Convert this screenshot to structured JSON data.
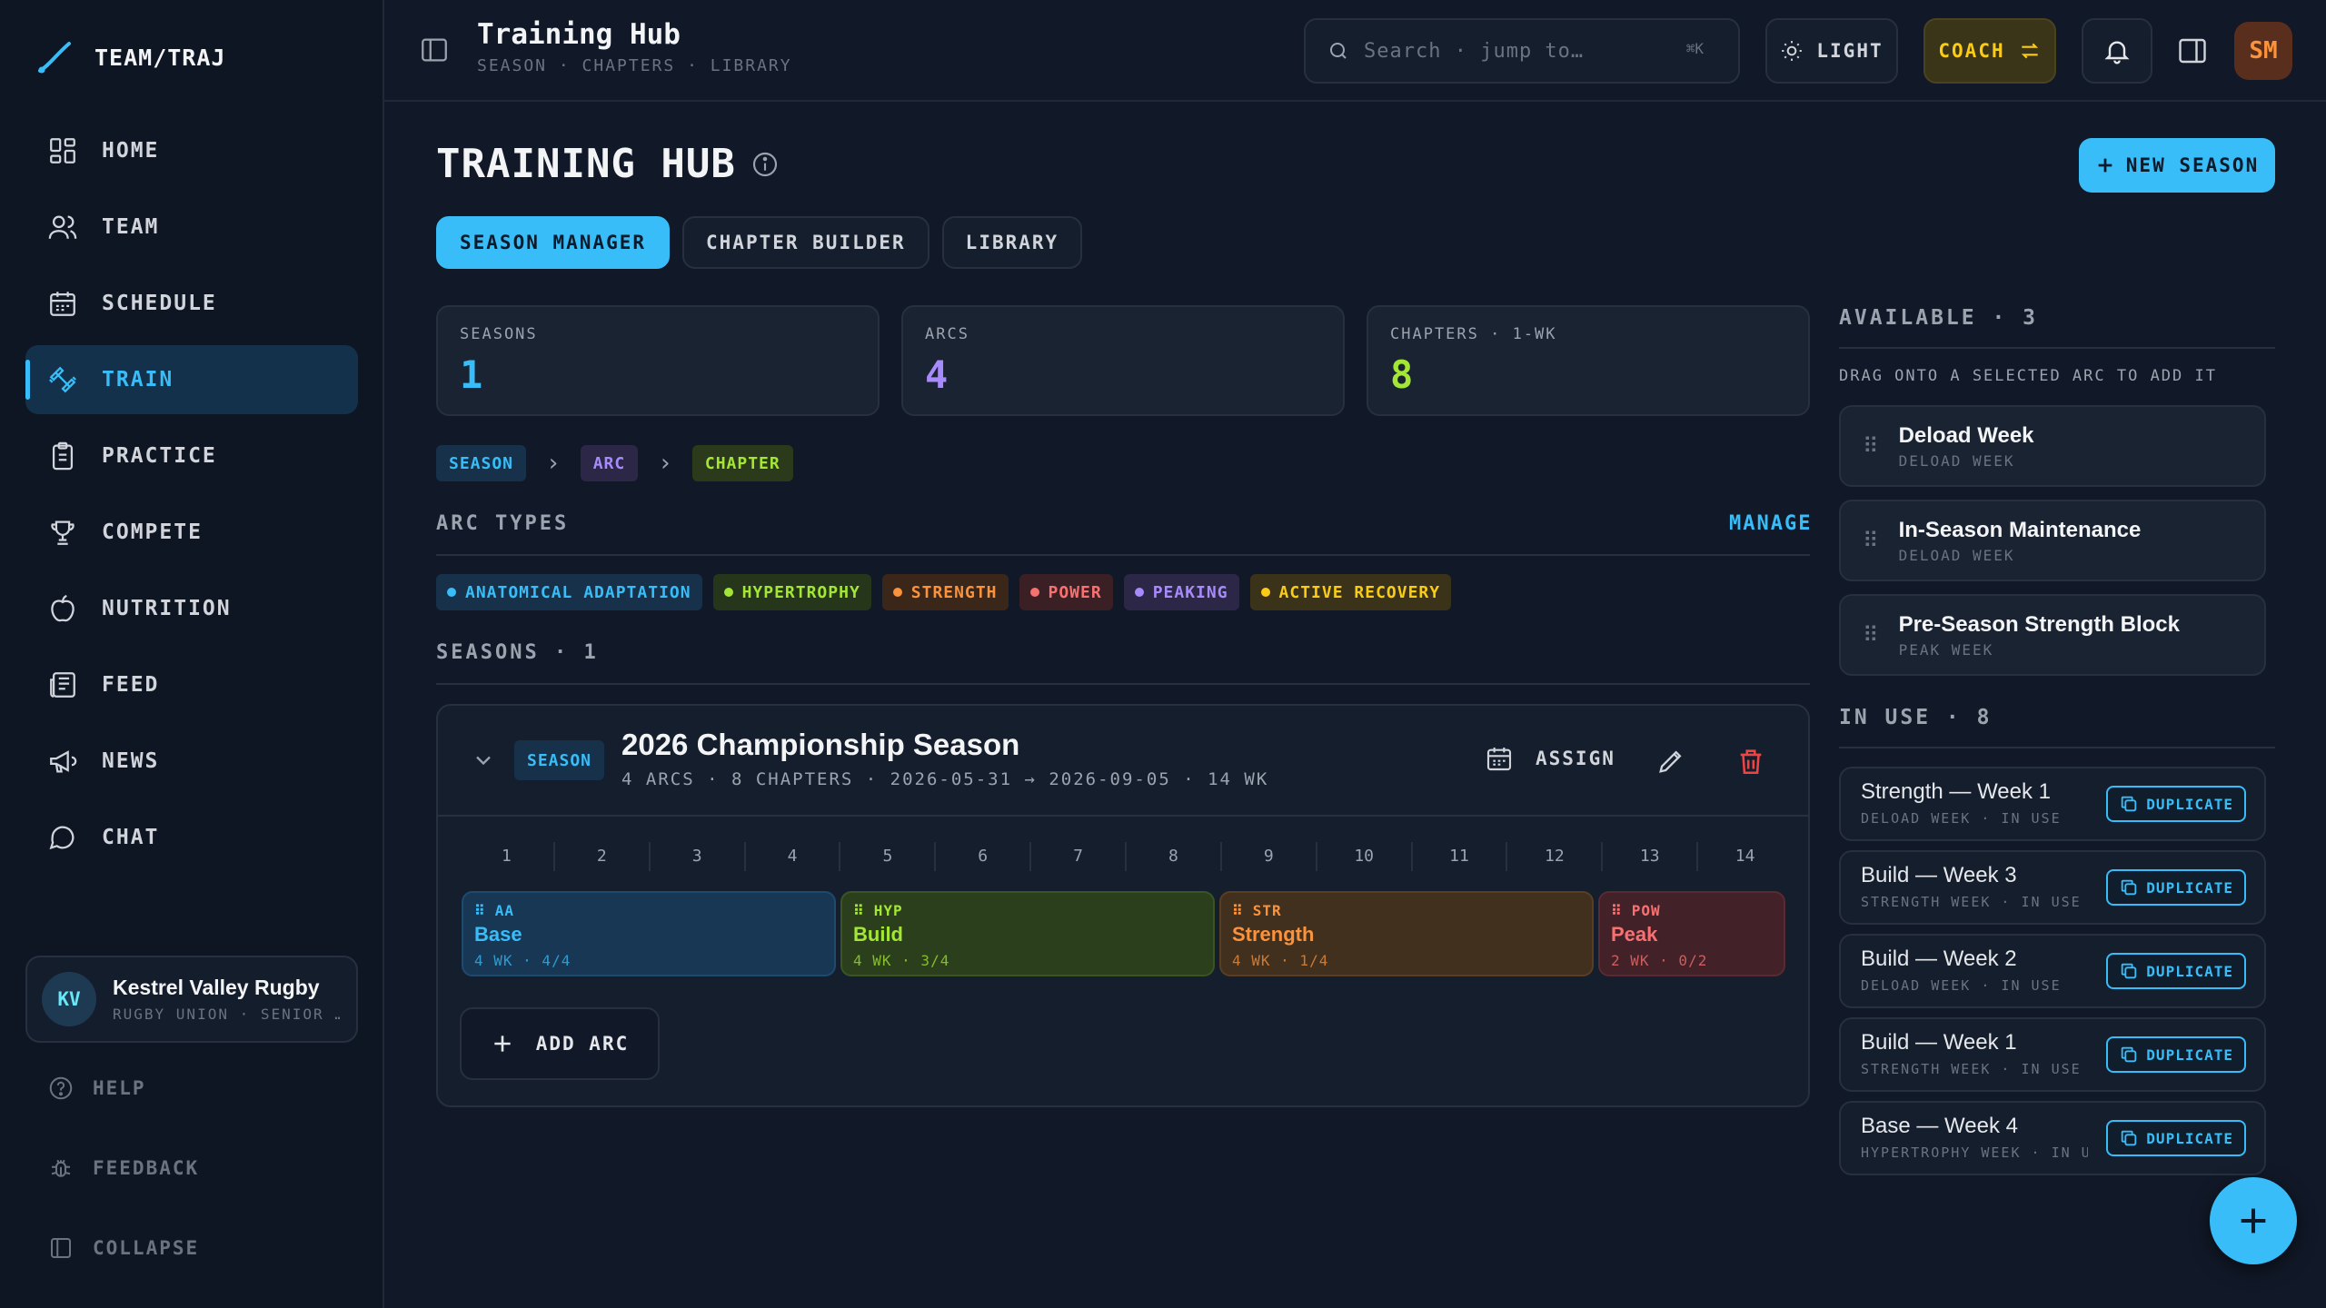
{
  "app": {
    "logo_text": "TEAM/TRAJ"
  },
  "sidebar": {
    "items": [
      {
        "label": "HOME",
        "icon": "grid-icon"
      },
      {
        "label": "TEAM",
        "icon": "users-icon"
      },
      {
        "label": "SCHEDULE",
        "icon": "calendar-icon"
      },
      {
        "label": "TRAIN",
        "icon": "dumbbell-icon",
        "active": true
      },
      {
        "label": "PRACTICE",
        "icon": "clipboard-icon"
      },
      {
        "label": "COMPETE",
        "icon": "trophy-icon"
      },
      {
        "label": "NUTRITION",
        "icon": "apple-icon"
      },
      {
        "label": "FEED",
        "icon": "newspaper-icon"
      },
      {
        "label": "NEWS",
        "icon": "megaphone-icon"
      },
      {
        "label": "CHAT",
        "icon": "chat-icon"
      }
    ],
    "team": {
      "initials": "KV",
      "name": "Kestrel Valley Rugby",
      "sub": "RUGBY UNION · SENIOR …"
    },
    "footer": {
      "help": "HELP",
      "feedback": "FEEDBACK",
      "collapse": "COLLAPSE"
    }
  },
  "header": {
    "title": "Training Hub",
    "crumbs": "SEASON · CHAPTERS · LIBRARY",
    "search_placeholder": "Search · jump to…",
    "search_shortcut": "⌘K",
    "theme_label": "LIGHT",
    "role_label": "COACH",
    "user_initials": "SM"
  },
  "main": {
    "title": "TRAINING HUB",
    "new_season": "NEW SEASON",
    "tabs": [
      "SEASON MANAGER",
      "CHAPTER BUILDER",
      "LIBRARY"
    ],
    "stats": [
      {
        "label": "SEASONS",
        "value": "1",
        "color": "#38bdf8"
      },
      {
        "label": "ARCS",
        "value": "4",
        "color": "#a78bfa"
      },
      {
        "label": "CHAPTERS · 1-WK",
        "value": "8",
        "color": "#a3e635"
      }
    ],
    "hierarchy": [
      "SEASON",
      "ARC",
      "CHAPTER"
    ],
    "arc_types_heading": "ARC TYPES",
    "manage": "MANAGE",
    "arc_types": [
      {
        "label": "ANATOMICAL ADAPTATION",
        "color": "#38bdf8"
      },
      {
        "label": "HYPERTROPHY",
        "color": "#a3e635"
      },
      {
        "label": "STRENGTH",
        "color": "#fb923c"
      },
      {
        "label": "POWER",
        "color": "#f87171"
      },
      {
        "label": "PEAKING",
        "color": "#a78bfa"
      },
      {
        "label": "ACTIVE RECOVERY",
        "color": "#facc15"
      }
    ],
    "seasons_heading": "SEASONS · 1",
    "season": {
      "badge": "SEASON",
      "title": "2026 Championship Season",
      "sub": "4 ARCS · 8 CHAPTERS · 2026-05-31 → 2026-09-05 · 14 WK",
      "assign": "ASSIGN",
      "weeks": [
        "1",
        "2",
        "3",
        "4",
        "5",
        "6",
        "7",
        "8",
        "9",
        "10",
        "11",
        "12",
        "13",
        "14"
      ],
      "arcs": [
        {
          "code": "AA",
          "name": "Base",
          "meta": "4 WK · 4/4"
        },
        {
          "code": "HYP",
          "name": "Build",
          "meta": "4 WK · 3/4"
        },
        {
          "code": "STR",
          "name": "Strength",
          "meta": "4 WK · 1/4"
        },
        {
          "code": "POW",
          "name": "Peak",
          "meta": "2 WK · 0/2"
        }
      ],
      "add_arc": "ADD ARC"
    }
  },
  "right": {
    "available_heading": "AVAILABLE · 3",
    "available_note": "DRAG ONTO A SELECTED ARC TO ADD IT",
    "available": [
      {
        "title": "Deload Week",
        "sub": "DELOAD WEEK"
      },
      {
        "title": "In-Season Maintenance",
        "sub": "DELOAD WEEK"
      },
      {
        "title": "Pre-Season Strength Block",
        "sub": "PEAK WEEK"
      }
    ],
    "inuse_heading": "IN USE · 8",
    "duplicate": "DUPLICATE",
    "inuse": [
      {
        "title": "Strength — Week 1",
        "sub": "DELOAD WEEK · IN USE"
      },
      {
        "title": "Build — Week 3",
        "sub": "STRENGTH WEEK · IN USE"
      },
      {
        "title": "Build — Week 2",
        "sub": "DELOAD WEEK · IN USE"
      },
      {
        "title": "Build — Week 1",
        "sub": "STRENGTH WEEK · IN USE"
      },
      {
        "title": "Base — Week 4",
        "sub": "HYPERTROPHY WEEK · IN U…"
      }
    ]
  }
}
